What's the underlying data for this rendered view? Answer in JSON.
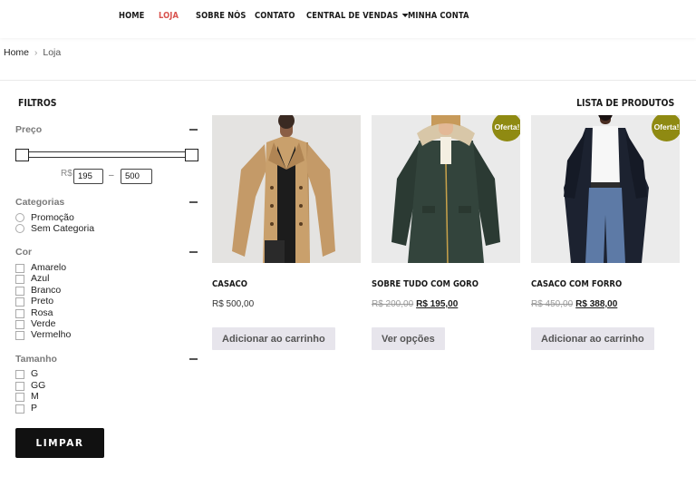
{
  "nav": {
    "items": [
      {
        "label": "HOME"
      },
      {
        "label": "LOJA"
      },
      {
        "label": "SOBRE NÓS"
      },
      {
        "label": "CONTATO"
      },
      {
        "label": "CENTRAL DE VENDAS"
      },
      {
        "label": "MINHA CONTA"
      }
    ],
    "active_color": "#d9534f"
  },
  "breadcrumb": {
    "home": "Home",
    "separator": "›",
    "current": "Loja"
  },
  "filters": {
    "title": "FILTROS",
    "price": {
      "title": "Preço",
      "currency": "R$",
      "min_value": "195",
      "max_value": "500",
      "separator": "–"
    },
    "categories": {
      "title": "Categorias",
      "options": [
        "Promoção",
        "Sem Categoria"
      ]
    },
    "color": {
      "title": "Cor",
      "options": [
        "Amarelo",
        "Azul",
        "Branco",
        "Preto",
        "Rosa",
        "Verde",
        "Vermelho"
      ]
    },
    "size": {
      "title": "Tamanho",
      "options": [
        "G",
        "GG",
        "M",
        "P"
      ]
    },
    "clear_label": "LIMPAR"
  },
  "products": {
    "title": "LISTA DE PRODUTOS",
    "sale_badge": "Oferta!",
    "sale_color": "#8f8a12",
    "items": [
      {
        "name": "CASACO",
        "price": "R$ 500,00",
        "old_price": "",
        "new_price": "",
        "button": "Adicionar ao carrinho",
        "image_icon": "tan-trench-coat-photo"
      },
      {
        "name": "SOBRE TUDO COM GORO",
        "price": "",
        "old_price": "R$ 200,00",
        "new_price": "R$ 195,00",
        "button": "Ver opções",
        "image_icon": "dark-green-parka-photo"
      },
      {
        "name": "CASACO COM FORRO",
        "price": "",
        "old_price": "R$ 450,00",
        "new_price": "R$ 388,00",
        "button": "Adicionar ao carrinho",
        "image_icon": "navy-long-coat-photo"
      }
    ]
  }
}
